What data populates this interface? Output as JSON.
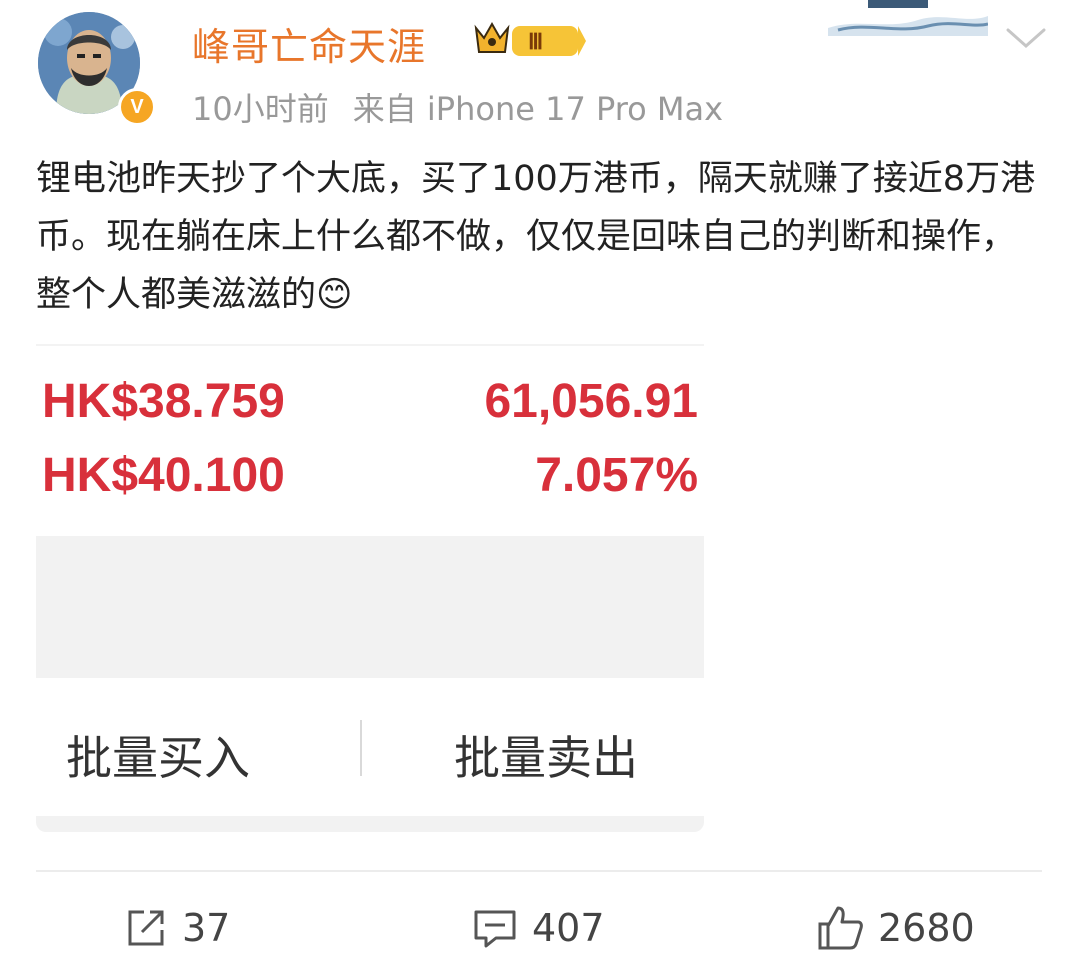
{
  "user": {
    "name": "峰哥亡命天涯",
    "vip_level": "Ⅲ",
    "verified_mark": "V",
    "time": "10小时前",
    "source": "来自 iPhone 17 Pro Max"
  },
  "post": {
    "text": "锂电池昨天抄了个大底，买了100万港币，隔天就赚了接近8万港币。现在躺在床上什么都不做，仅仅是回味自己的判断和操作，整个人都美滋滋的😊"
  },
  "trade_card": {
    "price_1": "HK$38.759",
    "value_1": "61,056.91",
    "price_2": "HK$40.100",
    "value_2": "7.057%",
    "buy_label": "批量买入",
    "sell_label": "批量卖出",
    "accent_color": "#d8303b"
  },
  "actions": {
    "repost_count": "37",
    "comment_count": "407",
    "like_count": "2680"
  },
  "icons": [
    "avatar",
    "verified-badge-icon",
    "crown-vip-icon",
    "chevron-down-icon",
    "repost-icon",
    "comment-icon",
    "like-icon"
  ]
}
